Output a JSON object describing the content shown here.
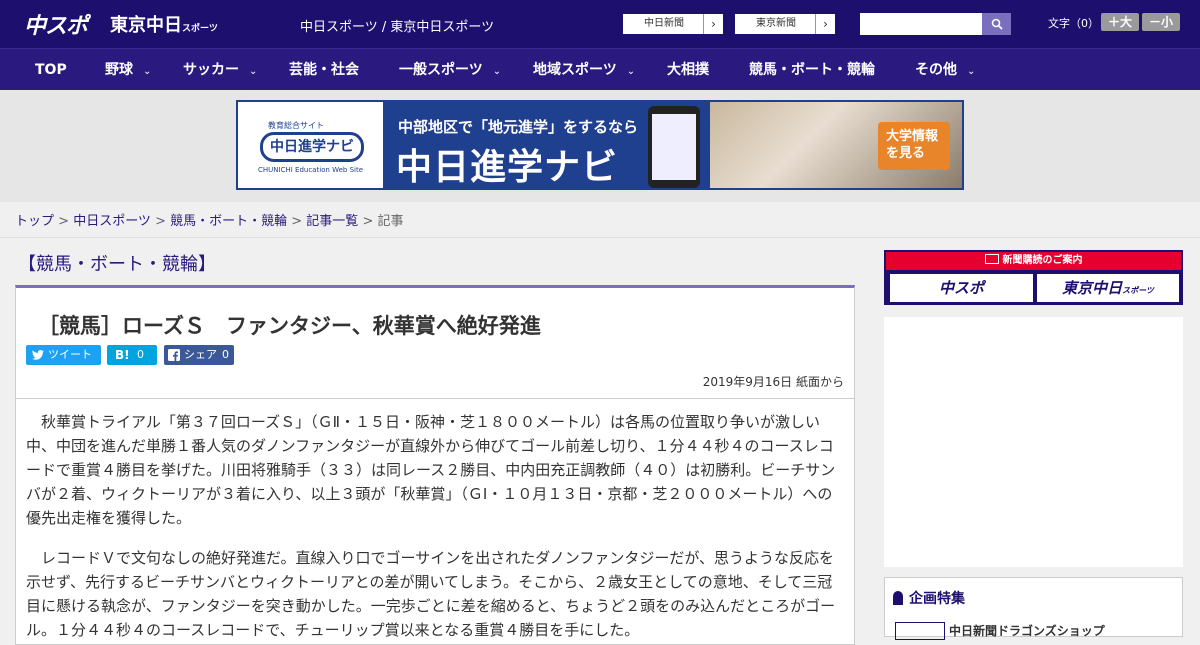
{
  "header": {
    "logo_chuspo": "中スポ",
    "logo_tokyo": "東京中日",
    "logo_tokyo_small": "スポーツ",
    "site_title": "中日スポーツ / 東京中日スポーツ",
    "paper_links": [
      {
        "label": "中日新聞",
        "arrow": "›"
      },
      {
        "label": "東京新聞",
        "arrow": "›"
      }
    ],
    "search": {
      "value": "",
      "placeholder": ""
    },
    "font_size": {
      "label": "文字（0）",
      "bigger": "＋大",
      "smaller": "－小"
    }
  },
  "nav": {
    "items": [
      {
        "label": "TOP",
        "has_menu": false
      },
      {
        "label": "野球",
        "has_menu": true
      },
      {
        "label": "サッカー",
        "has_menu": true
      },
      {
        "label": "芸能・社会",
        "has_menu": false
      },
      {
        "label": "一般スポーツ",
        "has_menu": true
      },
      {
        "label": "地域スポーツ",
        "has_menu": true
      },
      {
        "label": "大相撲",
        "has_menu": false
      },
      {
        "label": "競馬・ボート・競輪",
        "has_menu": false
      },
      {
        "label": "その他",
        "has_menu": true
      }
    ],
    "chevron": "⌄"
  },
  "banner": {
    "edu_small": "教育総合サイト",
    "edu_logo": "中日進学ナビ",
    "edu_sub": "CHUNICHI Education Web Site",
    "tagline": "中部地区で「地元進学」をするなら",
    "headline": "中日進学ナビ",
    "cta": "大学情報を見る"
  },
  "breadcrumb": {
    "items": [
      "トップ",
      "中日スポーツ",
      "競馬・ボート・競輪",
      "記事一覧"
    ],
    "separator": " > ",
    "current": "記事"
  },
  "article": {
    "category": "【競馬・ボート・競輪】",
    "title": "［競馬］ローズＳ　ファンタジー、秋華賞へ絶好発進",
    "share": {
      "tweet": "ツイート",
      "hatena_label": "B!",
      "hatena_count": "0",
      "facebook_label": "シェア",
      "facebook_count": "0"
    },
    "date": "2019年9月16日 紙面から",
    "paragraphs": [
      "秋華賞トライアル「第３７回ローズＳ」（ＧⅡ・１５日・阪神・芝１８００メートル）は各馬の位置取り争いが激しい中、中団を進んだ単勝１番人気のダノンファンタジーが直線外から伸びてゴール前差し切り、１分４４秒４のコースレコードで重賞４勝目を挙げた。川田将雅騎手（３３）は同レース２勝目、中内田充正調教師（４０）は初勝利。ビーチサンバが２着、ウィクトーリアが３着に入り、以上３頭が「秋華賞」（ＧⅠ・１０月１３日・京都・芝２０００メートル）への優先出走権を獲得した。",
      "レコードＶで文句なしの絶好発進だ。直線入り口でゴーサインを出されたダノンファンタジーだが、思うような反応を示せず、先行するビーチサンバとウィクトーリアとの差が開いてしまう。そこから、２歳女王としての意地、そして三冠目に懸ける執念が、ファンタジーを突き動かした。一完歩ごとに差を縮めると、ちょうど２頭をのみ込んだところがゴール。１分４４秒４のコースレコードで、チューリップ賞以来となる重賞４勝目を手にした。"
    ]
  },
  "sidebar": {
    "subscribe_head": "新聞購読のご案内",
    "subscribe_chuspo": "中スポ",
    "subscribe_tokyo": "東京中日",
    "subscribe_tokyo_small": "スポーツ",
    "feature_head": "企画特集",
    "feature_item": "中日新聞ドラゴンズショップ"
  },
  "colors": {
    "header_bg": "#1c0f6e",
    "nav_bg": "#2a1a80",
    "accent": "#7a6fbf",
    "subscribe_red": "#e6002d",
    "twitter": "#1da1f2",
    "hatena": "#00a4de",
    "facebook": "#3b5998"
  }
}
